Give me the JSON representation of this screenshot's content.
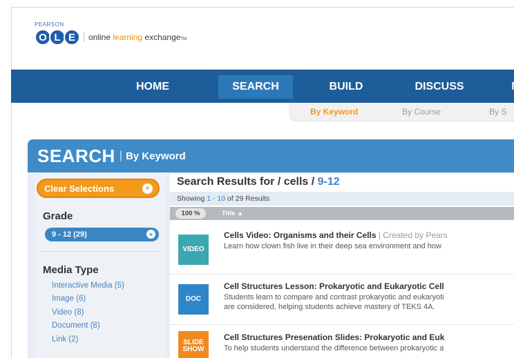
{
  "logo": {
    "company": "PEARSON",
    "letters": [
      "O",
      "L",
      "E"
    ],
    "tagline_a": "online ",
    "tagline_b": "learning",
    "tagline_c": " exchange",
    "tagline_tm": "TM"
  },
  "nav": {
    "items": [
      "HOME",
      "SEARCH",
      "BUILD",
      "DISCUSS",
      "N"
    ],
    "active": "SEARCH"
  },
  "subnav": {
    "items": [
      "By Keyword",
      "By Course",
      "By S"
    ],
    "active": "By Keyword"
  },
  "panel": {
    "title": "SEARCH",
    "separator": "|",
    "subtitle": "By Keyword"
  },
  "sidebar": {
    "clear_label": "Clear Selections",
    "clear_icon": "×",
    "grade_heading": "Grade",
    "grade_selected": "9 - 12 (29)",
    "grade_remove_icon": "×",
    "media_heading": "Media Type",
    "media_items": [
      "Interactive Media (5)",
      "Image (6)",
      "Video (8)",
      "Document (8)",
      "Link (2)"
    ]
  },
  "results": {
    "title_prefix": "Search Results for / cells / ",
    "title_grade": "9-12",
    "showing_prefix": "Showing ",
    "showing_range": "1 - 10",
    "showing_suffix": " of 29 Results",
    "relevance": "100 %",
    "column_title": "Title ▲",
    "rows": [
      {
        "type": "VIDEO",
        "title": "Cells Video: Organisms and their Cells",
        "byline": " | Created by Pears",
        "desc1": "Learn how clown fish live in their deep sea environment and how",
        "desc2": ""
      },
      {
        "type": "DOC",
        "title": "Cell Structures Lesson: Prokaryotic and Eukaryotic Cell",
        "byline": "",
        "desc1": "Students learn to compare and contrast prokaryotic and eukaryoti",
        "desc2": "are considered, helping students achieve mastery of TEKS 4A."
      },
      {
        "type": "SLIDE SHOW",
        "title": "Cell Structures Presenation Slides: Prokaryotic and Euk",
        "byline": "",
        "desc1": "To help students understand the difference between prokaryotic a",
        "desc2": ""
      }
    ]
  },
  "colors": {
    "nav_blue": "#1c5d9a",
    "panel_blue": "#3f8bc7",
    "accent_orange": "#f39a1e",
    "link_blue": "#4a84c0"
  }
}
